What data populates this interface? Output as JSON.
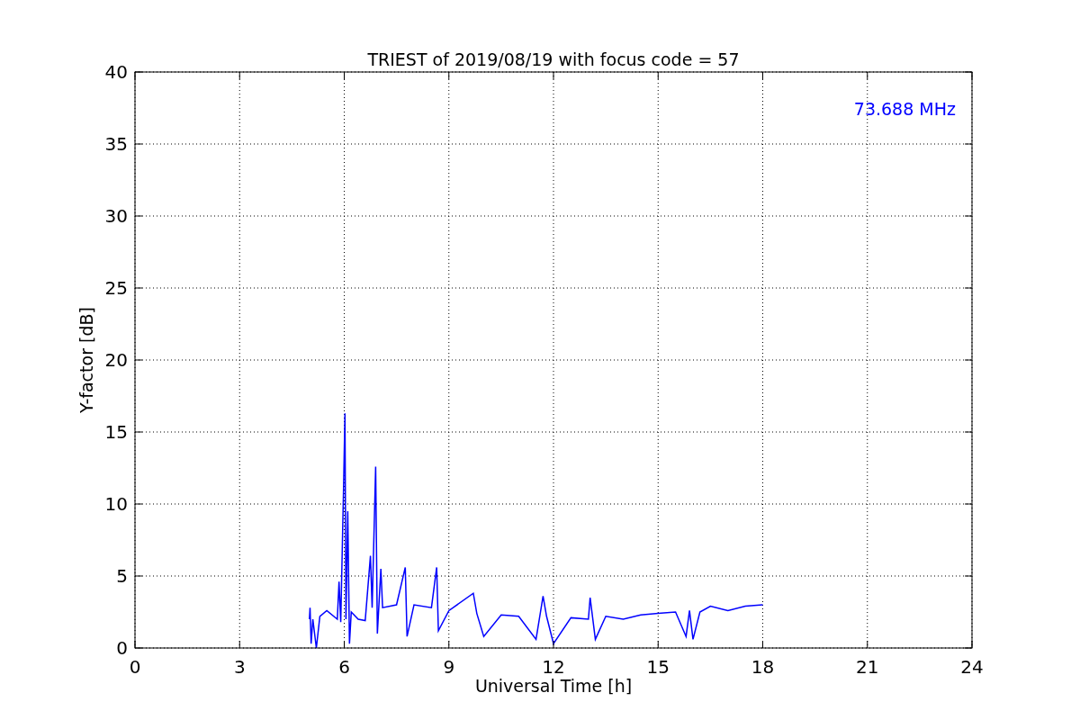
{
  "figure": {
    "chart_data": {
      "type": "line",
      "title": "TRIEST of 2019/08/19 with focus code = 57",
      "xlabel": "Universal Time [h]",
      "ylabel": "Y-factor [dB]",
      "xlim": [
        0,
        24
      ],
      "ylim": [
        0,
        40
      ],
      "xticks": [
        0,
        3,
        6,
        9,
        12,
        15,
        18,
        21,
        24
      ],
      "yticks": [
        0,
        5,
        10,
        15,
        20,
        25,
        30,
        35,
        40
      ],
      "x": [
        5.0,
        5.02,
        5.05,
        5.1,
        5.2,
        5.3,
        5.5,
        5.8,
        5.85,
        5.9,
        5.98,
        6.02,
        6.05,
        6.1,
        6.15,
        6.2,
        6.4,
        6.6,
        6.75,
        6.8,
        6.9,
        6.95,
        7.05,
        7.1,
        7.5,
        7.75,
        7.8,
        8.0,
        8.5,
        8.65,
        8.7,
        9.0,
        9.7,
        9.8,
        10.0,
        10.5,
        11.0,
        11.5,
        11.7,
        11.8,
        12.0,
        12.5,
        13.0,
        13.05,
        13.2,
        13.5,
        14.0,
        14.5,
        15.0,
        15.5,
        15.8,
        15.9,
        16.0,
        16.2,
        16.5,
        17.0,
        17.5,
        18.0
      ],
      "series": [
        {
          "name": "73.688 MHz",
          "color": "#0000ff",
          "values": [
            2.0,
            2.8,
            0.3,
            2.0,
            0.0,
            2.2,
            2.6,
            2.0,
            4.6,
            1.8,
            11.0,
            16.3,
            2.0,
            9.5,
            0.3,
            2.5,
            2.0,
            1.9,
            6.4,
            2.8,
            12.6,
            1.0,
            5.5,
            2.8,
            3.0,
            5.6,
            0.8,
            3.0,
            2.8,
            5.6,
            1.2,
            2.6,
            3.8,
            2.4,
            0.8,
            2.3,
            2.2,
            0.6,
            3.6,
            2.2,
            0.3,
            2.1,
            2.0,
            3.5,
            0.6,
            2.2,
            2.0,
            2.3,
            2.4,
            2.5,
            0.8,
            2.6,
            0.6,
            2.5,
            2.9,
            2.6,
            2.9,
            3.0
          ]
        }
      ],
      "grid": true
    }
  }
}
